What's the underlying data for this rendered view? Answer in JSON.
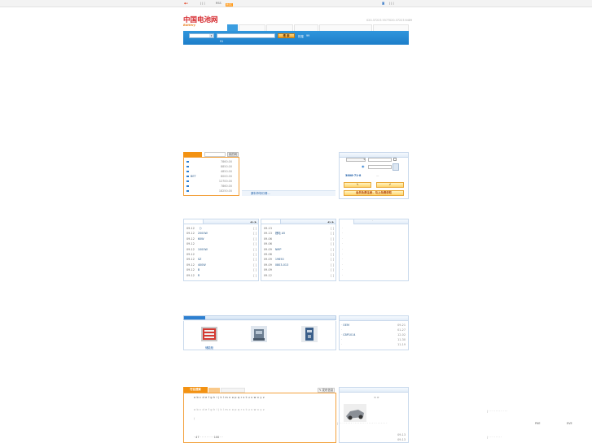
{
  "topbar": {
    "links": "|   |   |",
    "rss": "RSS",
    "right": "|   |   |"
  },
  "logo": {
    "main": "中国电池网",
    "sub": "Battery"
  },
  "header": {
    "phone_1": "020-37223 5577",
    "phone_2": "020-37223 6489"
  },
  "search": {
    "button": "搜 索",
    "hot_label": "热搜",
    "hot_text": "99",
    "note": "91"
  },
  "left_box": {
    "button": "我的网",
    "rows": [
      {
        "text": "",
        "value": "7860.00"
      },
      {
        "text": "",
        "value": "8850.00"
      },
      {
        "text": "",
        "value": "4850.00"
      },
      {
        "text": "BET",
        "value": "8000.00"
      },
      {
        "text": "",
        "value": "12700.00"
      },
      {
        "text": "",
        "value": "7860.00"
      },
      {
        "text": "",
        "value": "18250.00"
      }
    ]
  },
  "mid_caption": "原料市场行情...",
  "login": {
    "remember": "",
    "user_id": "3808-71-8",
    "free_tip": "会员免费注册，马上免费获取"
  },
  "news_left": [
    {
      "date": "09-12",
      "title": "（）"
    },
    {
      "date": "09-12",
      "title": "2000W"
    },
    {
      "date": "09-12",
      "title": "60W"
    },
    {
      "date": "09-12",
      "title": ""
    },
    {
      "date": "09-12",
      "title": "1000W"
    },
    {
      "date": "09-12",
      "title": ""
    },
    {
      "date": "09-12",
      "title": "SZ"
    },
    {
      "date": "09-12",
      "title": "400W"
    },
    {
      "date": "09-12",
      "title": "B"
    },
    {
      "date": "09-12",
      "title": "R"
    }
  ],
  "news_mid": [
    {
      "date": "09-13",
      "title": ""
    },
    {
      "date": "09-13",
      "title": "锂电 A5"
    },
    {
      "date": "09-06",
      "title": ""
    },
    {
      "date": "09-06",
      "title": ""
    },
    {
      "date": "09-09",
      "title": "NMP"
    },
    {
      "date": "09-06",
      "title": ""
    },
    {
      "date": "09-09",
      "title": "19650"
    },
    {
      "date": "09-09",
      "title": "0803-013"
    },
    {
      "date": "09-09",
      "title": ""
    },
    {
      "date": "09-12",
      "title": ""
    }
  ],
  "products": {
    "label_1": "储能柜",
    "right_items": [
      {
        "text": "OEM",
        "date": "09-21"
      },
      {
        "text": "",
        "date": "01-27"
      },
      {
        "text": "CBP1014",
        "date": "12-02"
      },
      {
        "text": "",
        "date": "11-30"
      },
      {
        "text": "",
        "date": "11-19"
      }
    ]
  },
  "bottom": {
    "tab": "行业搜索",
    "right_btn": "发布信息",
    "letters": "a b c d e f g h i j k l m n o p q r s t u v w x y z",
    "counter": "100",
    "right_dates": [
      "09-13",
      "09-13"
    ],
    "arrows": "< >",
    "misc_right_1": "PXE",
    "misc_right_2": "EVE"
  },
  "colors": {
    "brand_blue": "#2f95dc",
    "accent_orange": "#f39212",
    "logo_red": "#d5262b"
  }
}
